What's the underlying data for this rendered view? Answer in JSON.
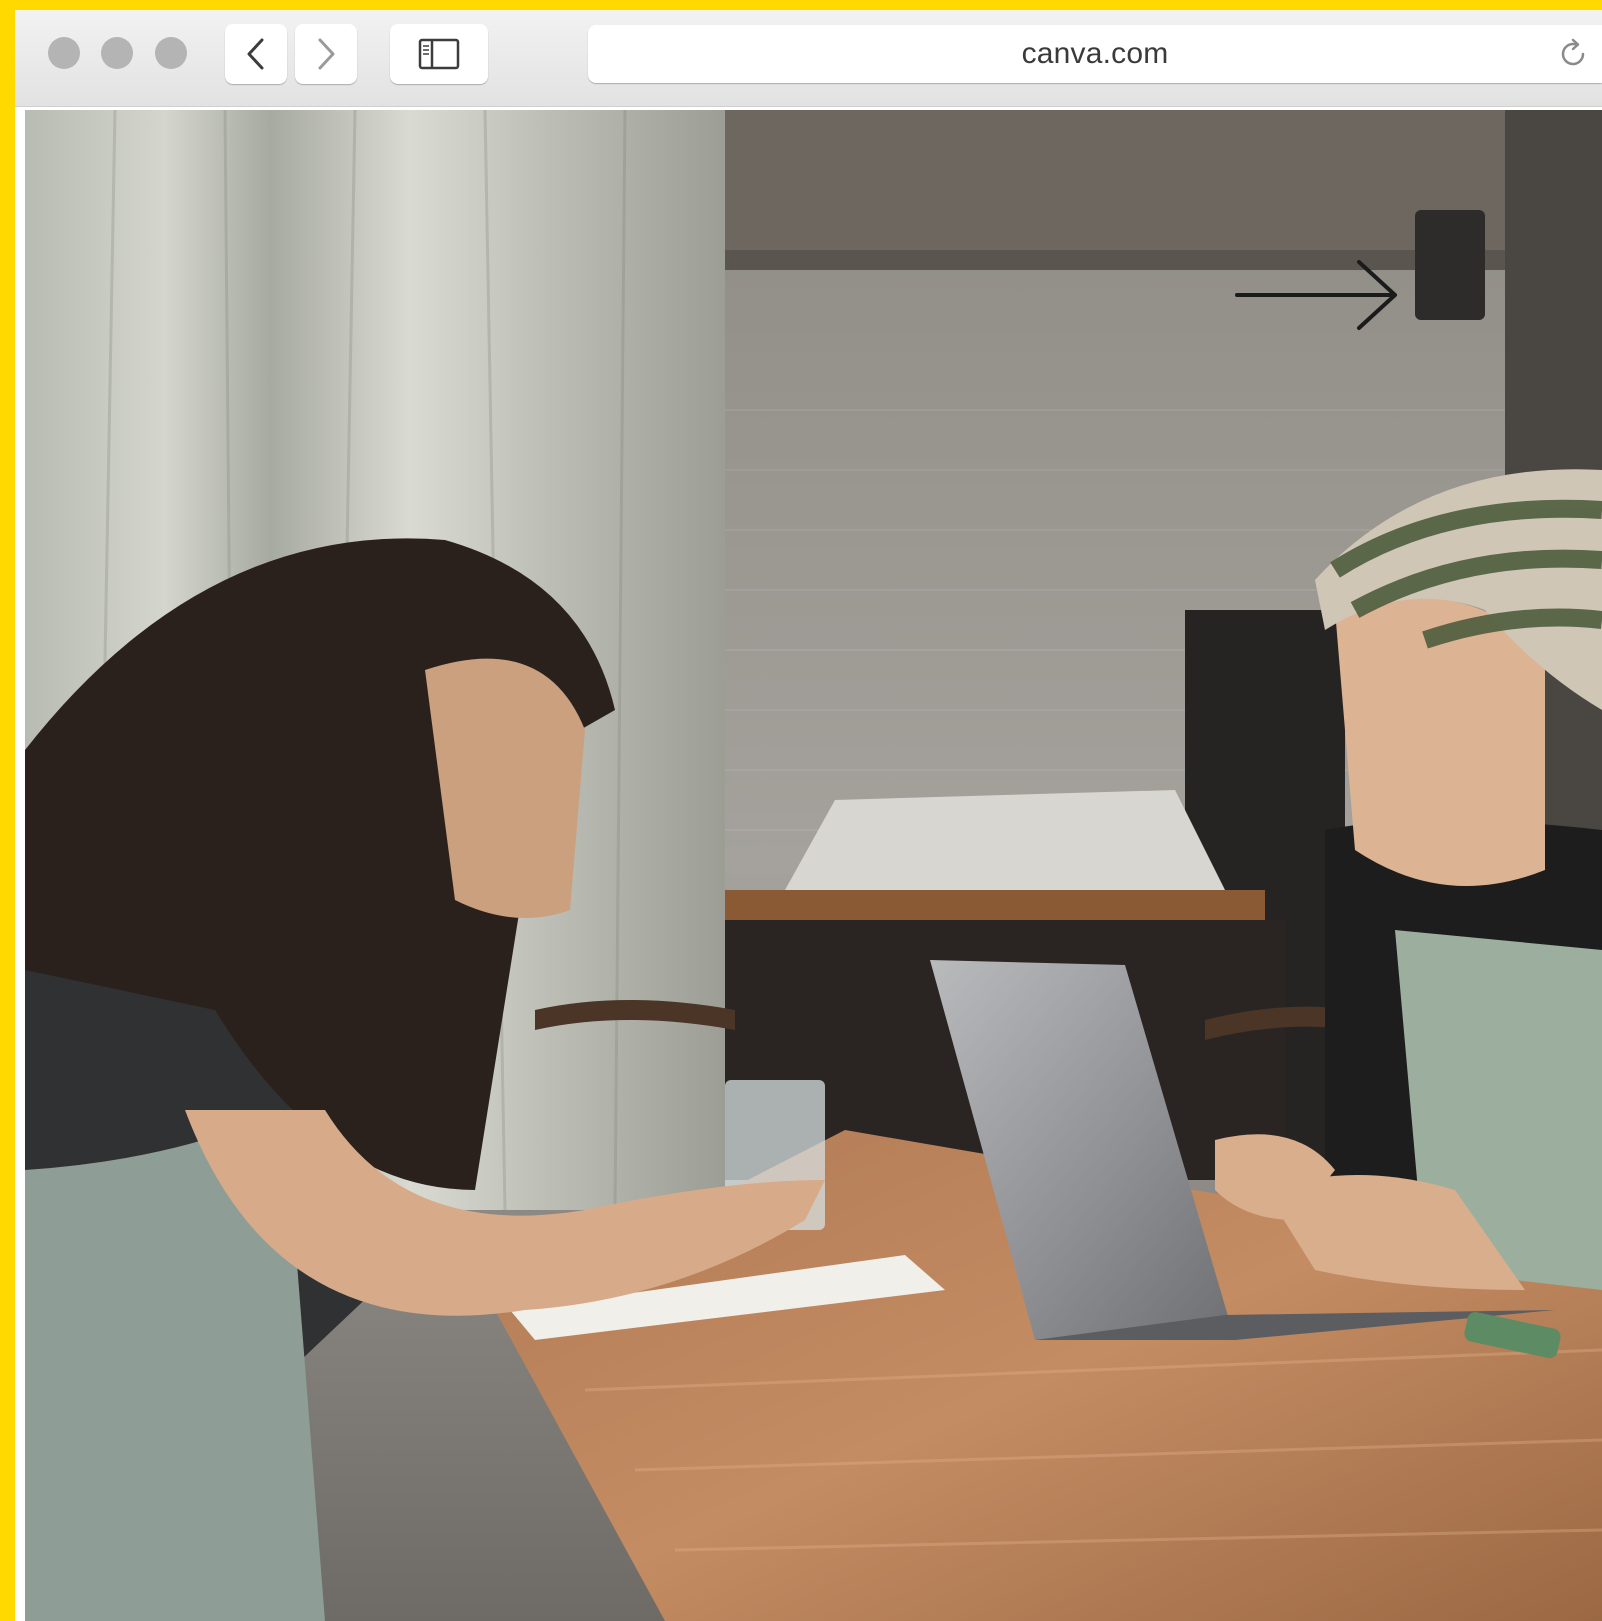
{
  "browser": {
    "url": "canva.com",
    "traffic_lights": [
      "close-button",
      "minimize-button",
      "zoom-button"
    ],
    "icons": {
      "back": "chevron-left-icon",
      "forward": "chevron-right-icon",
      "sidebar": "sidebar-icon",
      "reload": "reload-icon"
    },
    "colors": {
      "frame_accent": "#ffd900",
      "toolbar": "#e8e8e8",
      "traffic_light": "#b4b4b4"
    }
  },
  "page": {
    "photo_subject": "",
    "arrow_icon": "arrow-right-icon"
  }
}
